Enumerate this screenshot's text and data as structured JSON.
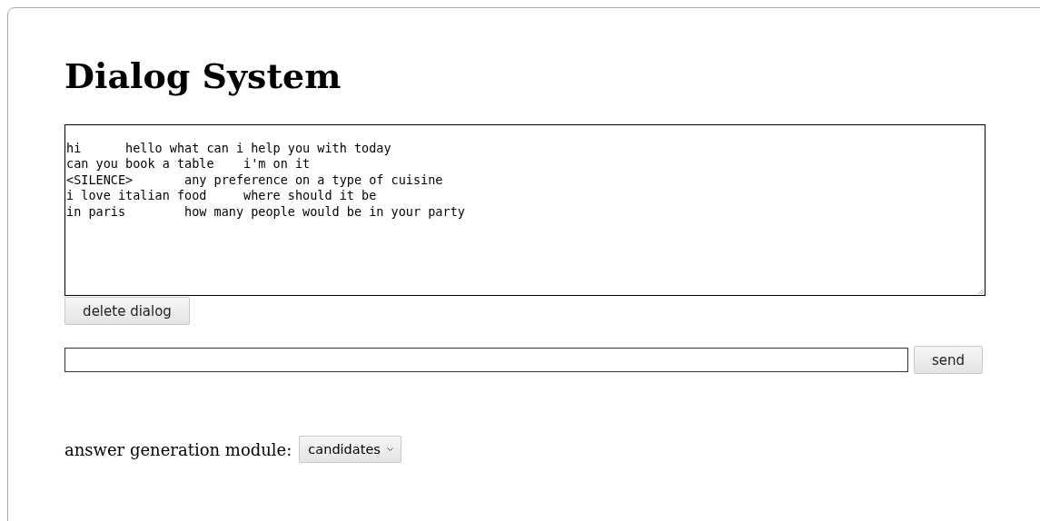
{
  "title": "Dialog System",
  "dialog": [
    {
      "user": "hi",
      "system": "hello what can i help you with today"
    },
    {
      "user": "can you book a table",
      "system": "i'm on it"
    },
    {
      "user": "<SILENCE>",
      "system": "any preference on a type of cuisine"
    },
    {
      "user": "i love italian food",
      "system": "where should it be"
    },
    {
      "user": "in paris",
      "system": "how many people would be in your party"
    }
  ],
  "delete_button": "delete dialog",
  "send_button": "send",
  "module": {
    "label": "answer generation module:",
    "value": "candidates"
  }
}
